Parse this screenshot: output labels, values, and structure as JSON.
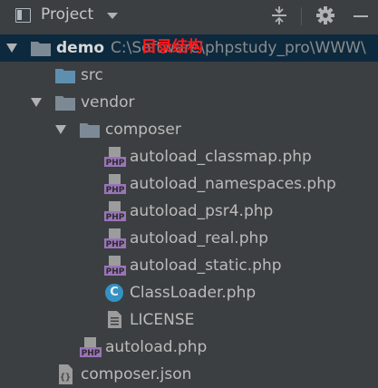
{
  "header": {
    "title": "Project"
  },
  "annotation": "目录结构",
  "tree": {
    "root": {
      "label": "demo",
      "path": "C:\\Software\\phpstudy_pro\\WWW\\"
    },
    "src": {
      "label": "src"
    },
    "vendor": {
      "label": "vendor"
    },
    "composer": {
      "label": "composer"
    },
    "files": [
      "autoload_classmap.php",
      "autoload_namespaces.php",
      "autoload_psr4.php",
      "autoload_real.php",
      "autoload_static.php",
      "ClassLoader.php",
      "LICENSE"
    ],
    "autoload": {
      "label": "autoload.php"
    },
    "composer_json": {
      "label": "composer.json"
    }
  },
  "icons": {
    "project": "project-view-icon",
    "collapse": "collapse-all-icon",
    "settings": "gear-icon",
    "hide": "minimize-icon",
    "folder": "folder-icon",
    "php": "php-file-icon",
    "class": "class-icon",
    "text": "text-file-icon",
    "json": "json-file-icon"
  },
  "colors": {
    "background": "#3c3f41",
    "selection": "#0d293e",
    "folder": "#7d8a96",
    "source_folder": "#5f8fb0",
    "php": "#9975b8",
    "class": "#3592c4",
    "annotation": "#ff1a1a"
  }
}
